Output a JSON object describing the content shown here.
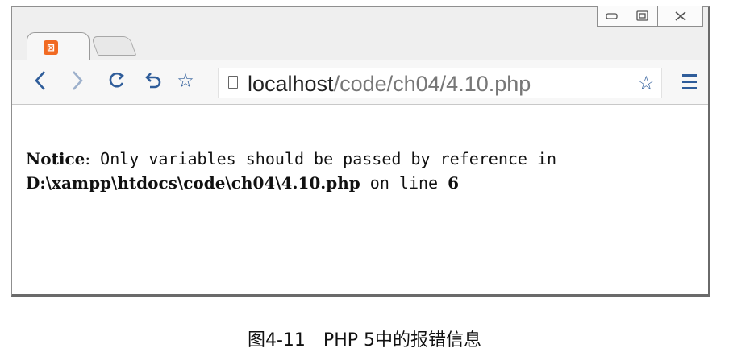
{
  "window_controls": {
    "minimize": "▭",
    "maximize": "▣",
    "close": "⤬"
  },
  "toolbar": {
    "url_host": "localhost",
    "url_path": "/code/ch04/4.10.php"
  },
  "notice": {
    "label": "Notice",
    "colon": ":",
    "message": " Only variables should be passed by reference in",
    "file_path": "D:\\xampp\\htdocs\\code\\ch04\\4.10.php",
    "on_line": " on line ",
    "line_number": "6"
  },
  "caption": "图4-11　PHP 5中的报错信息",
  "icons": [
    "xampp-logo-icon",
    "back-icon",
    "forward-icon",
    "reload-icon",
    "undo-icon",
    "bookmark-star-icon",
    "page-icon",
    "menu-icon"
  ],
  "colors": {
    "accent": "#2f5d9a",
    "xampp_orange": "#f16a22"
  }
}
